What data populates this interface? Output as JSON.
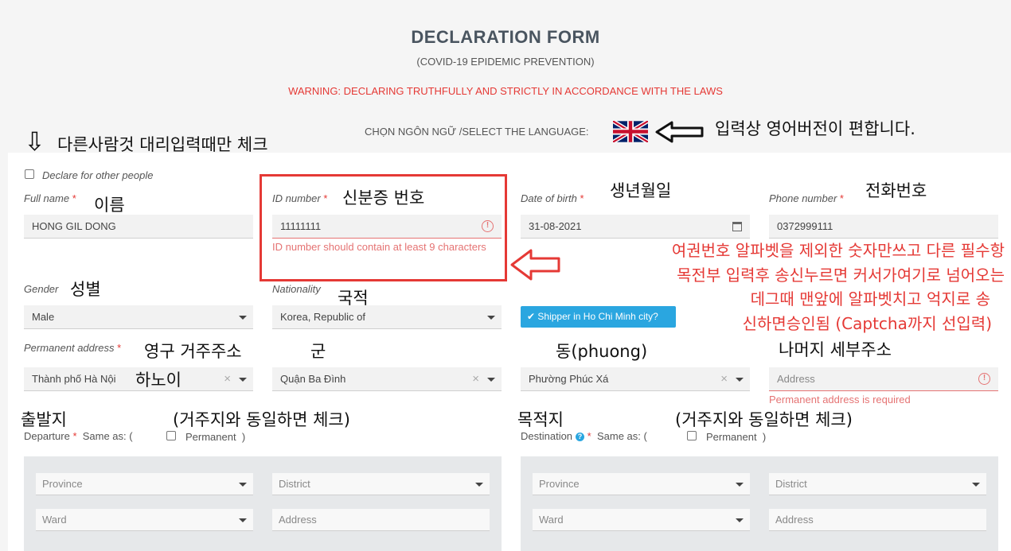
{
  "header": {
    "title": "DECLARATION FORM",
    "subtitle": "(COVID-19 EPIDEMIC PREVENTION)",
    "warning": "WARNING: DECLARING TRUTHFULLY AND STRICTLY IN ACCORDANCE WITH THE LAWS",
    "language_label": "CHỌN NGÔN NGỮ /SELECT THE LANGUAGE:",
    "language_flag": "uk-flag-icon"
  },
  "form": {
    "declare_other": "Declare for other people",
    "full_name": {
      "label": "Full name",
      "required": "*",
      "value": "HONG GIL DONG"
    },
    "id_number": {
      "label": "ID number",
      "required": "*",
      "value": "11111111",
      "error": "ID number should contain at least 9 characters"
    },
    "dob": {
      "label": "Date of birth",
      "required": "*",
      "value": "31-08-2021"
    },
    "phone": {
      "label": "Phone number",
      "required": "*",
      "value": "0372999111"
    },
    "gender": {
      "label": "Gender",
      "value": "Male"
    },
    "nationality": {
      "label": "Nationality",
      "value": "Korea, Republic of"
    },
    "shipper": "Shipper in Ho Chi Minh city?",
    "permanent": {
      "label": "Permanent address",
      "required": "*",
      "province": "Thành phố Hà Nội",
      "district": "Quận Ba Đình",
      "ward": "Phường Phúc Xá",
      "address_placeholder": "Address",
      "error": "Permanent address is required"
    },
    "departure": {
      "label": "Departure",
      "required": "*",
      "same_as": "Same as:",
      "paren_open": "(",
      "paren_close": ")",
      "option": "Permanent",
      "province": "Province",
      "district": "District",
      "ward": "Ward",
      "address": "Address"
    },
    "destination": {
      "label": "Destination",
      "required": "*",
      "same_as": "Same as:",
      "paren_open": "(",
      "paren_close": ")",
      "option": "Permanent",
      "province": "Province",
      "district": "District",
      "ward": "Ward",
      "address": "Address"
    }
  },
  "annotations": {
    "arrow_down": "⇩",
    "other_people": "다른사람것 대리입력때만 체크",
    "english_easy": "입력상 영어버전이 편합니다.",
    "name": "이름",
    "id": "신분증 번호",
    "dob": "생년월일",
    "phone": "전화번호",
    "gender": "성별",
    "nationality": "국적",
    "permanent": "영구 거주주소",
    "district": "군",
    "ward": "동(phuong)",
    "rest_address": "나머지 세부주소",
    "hanoi": "하노이",
    "departure": "출발지",
    "destination": "목적지",
    "same_dep": "(거주지와 동일하면 체크)",
    "same_dest": "(거주지와 동일하면 체크)",
    "red_note_1": "여권번호 알파벳을 제외한 숫자만쓰고 다른 필수항",
    "red_note_2": "목전부 입력후 송신누르면 커서가여기로 넘어오는",
    "red_note_3": "데그때 맨앞에 알파벳치고 억지로 송",
    "red_note_4": "신하면승인됨 (Captcha까지 선입력)"
  }
}
